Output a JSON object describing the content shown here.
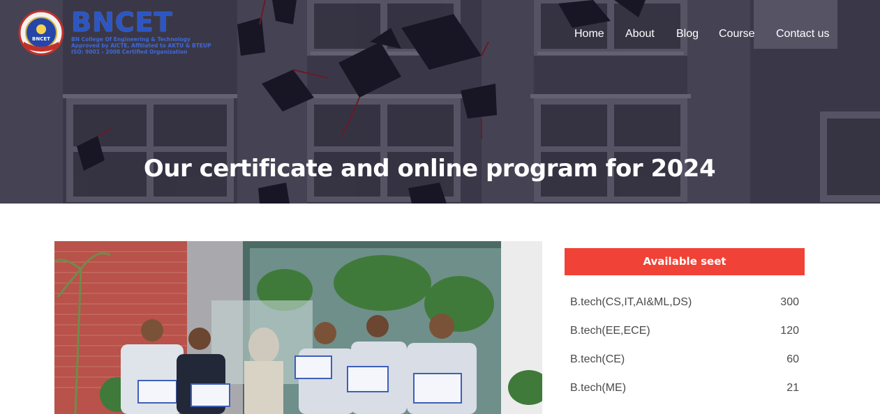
{
  "logo": {
    "name": "BNCET",
    "seal_top": "OF ENGINEERING",
    "seal_mid": "BNCET",
    "lines": [
      "BN College Of Engineering & Technology",
      "Approved by AICTE, Affiliated to AKTU & BTEUP",
      "ISO: 9001 - 2008 Certified Organization"
    ]
  },
  "nav": {
    "home": "Home",
    "about": "About",
    "blog": "Blog",
    "course": "Course",
    "contact": "Contact us"
  },
  "hero": {
    "title": "Our certificate and online program for 2024"
  },
  "seats": {
    "header": "Available seet",
    "rows": [
      {
        "course": "B.tech(CS,IT,AI&ML,DS)",
        "count": "300"
      },
      {
        "course": "B.tech(EE,ECE)",
        "count": "120"
      },
      {
        "course": "B.tech(CE)",
        "count": "60"
      },
      {
        "course": "B.tech(ME)",
        "count": "21"
      }
    ]
  },
  "colors": {
    "accent": "#f04236",
    "logo_blue": "#2b56c4",
    "nav_text": "#ffffff",
    "body_text": "#4a4a4a"
  }
}
